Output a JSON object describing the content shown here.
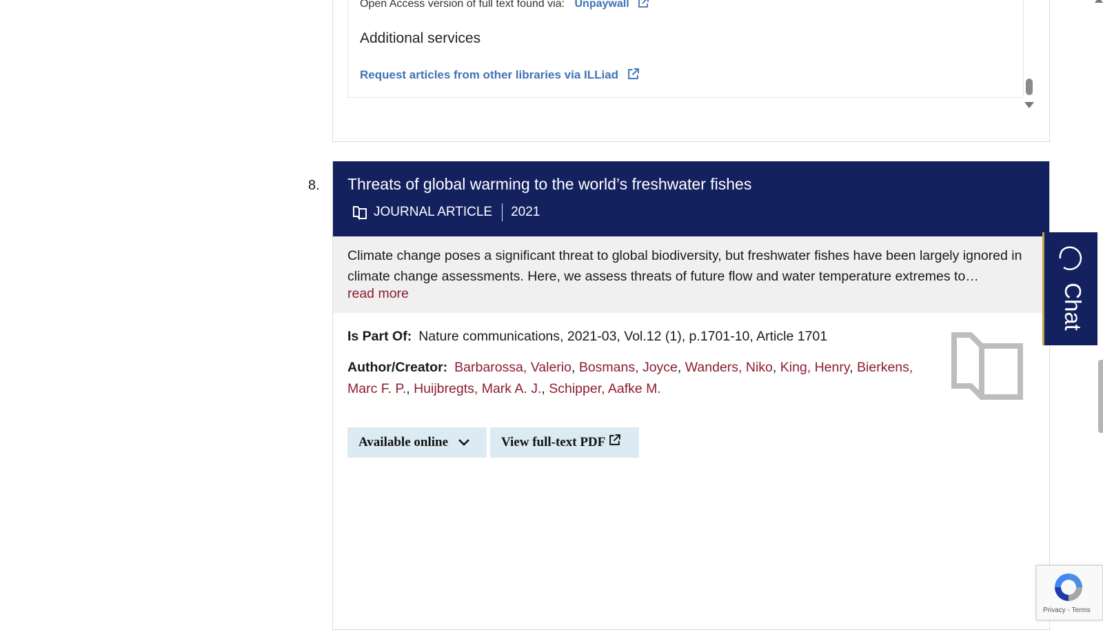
{
  "previous_result": {
    "open_access_label": "Open Access version of full text found via:",
    "open_access_link": "Unpaywall",
    "additional_services": "Additional services",
    "illiad_link": "Request articles from other libraries via ILLiad"
  },
  "result": {
    "number": "8.",
    "title": "Threats of global warming to the world’s freshwater fishes",
    "type": "JOURNAL ARTICLE",
    "year": "2021",
    "abstract": "Climate change poses a significant threat to global biodiversity, but freshwater fishes have been largely ignored in climate change assessments. Here, we assess threats of future flow and water temperature extremes to…",
    "read_more": "read more",
    "is_part_of_label": "Is Part Of:",
    "is_part_of": "Nature communications, 2021-03, Vol.12 (1), p.1701-10, Article 1701",
    "author_label": "Author/Creator:",
    "authors": [
      "Barbarossa, Valerio",
      "Bosmans, Joyce",
      "Wanders, Niko",
      "King, Henry",
      "Bierkens, Marc F. P.",
      "Huijbregts, Mark A. J.",
      "Schipper, Aafke M."
    ],
    "available_online": "Available online",
    "view_pdf": "View full-text PDF"
  },
  "chat": {
    "label": "Chat"
  },
  "recaptcha": {
    "privacy": "Privacy",
    "separator": " - ",
    "terms": "Terms"
  },
  "colors": {
    "header_bg": "#13215f",
    "link_blue": "#3f72b5",
    "author_red": "#8c1d2f",
    "button_bg": "#dceaf3",
    "abstract_bg": "#f0f0f0"
  },
  "icons": [
    "external-link-icon",
    "book-icon",
    "chevron-down-icon",
    "chat-bubble-icon",
    "recaptcha-logo-icon"
  ]
}
